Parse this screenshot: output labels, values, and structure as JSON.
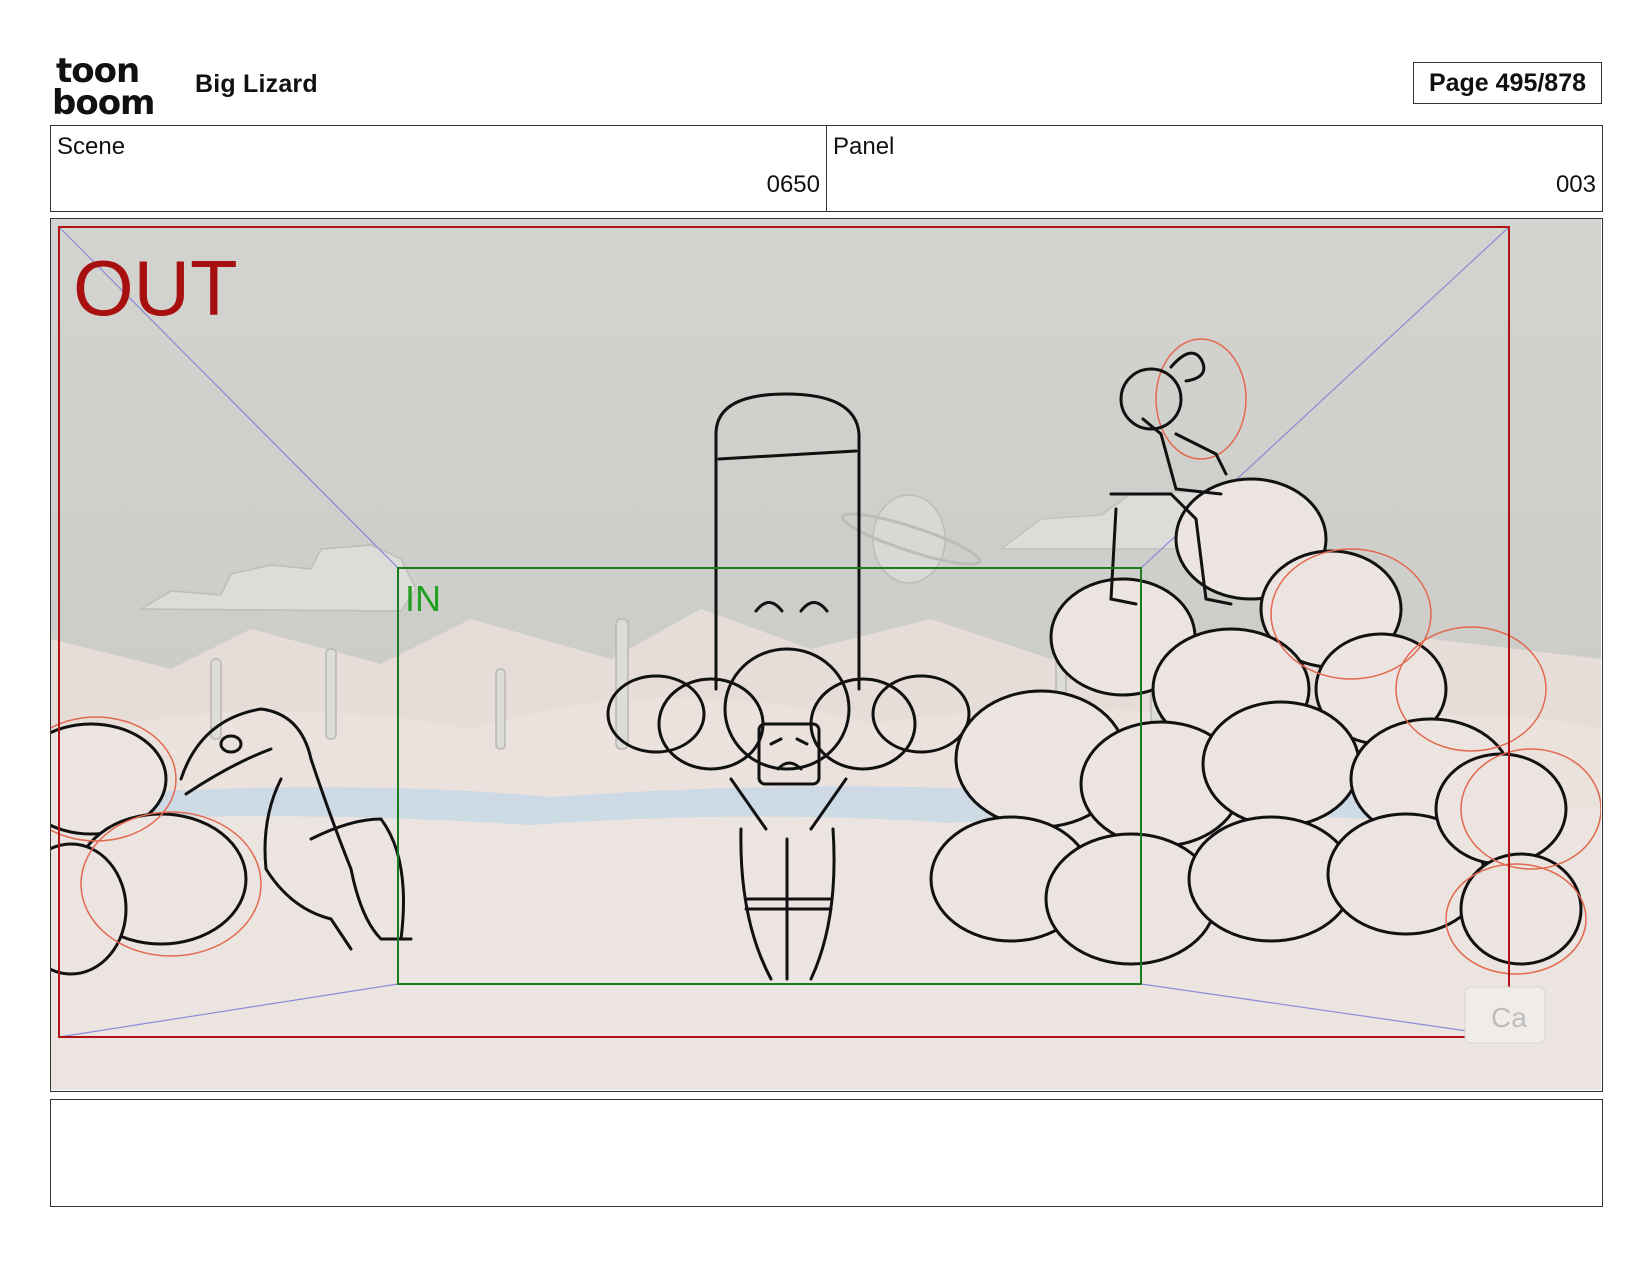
{
  "header": {
    "logo": {
      "icon": "toonboom-logo",
      "line1": "toon",
      "line2": "boom"
    },
    "project_title": "Big Lizard",
    "page_indicator": "Page 495/878"
  },
  "scene": {
    "label": "Scene",
    "value": "0650"
  },
  "panel": {
    "label": "Panel",
    "value": "003"
  },
  "frame": {
    "out_label": "OUT",
    "in_label": "IN",
    "corner_tag": "Ca",
    "colors": {
      "out_frame": "#b01414",
      "in_frame": "#1e7a1e",
      "in_text": "#22a022",
      "guides": "#8a8ad8",
      "sketch": "#111111",
      "rough": "#e2694d",
      "sky": "#cfcfcb",
      "ground": "#e8dfdb",
      "water": "#c3d6e6"
    }
  },
  "caption": {
    "text": ""
  }
}
